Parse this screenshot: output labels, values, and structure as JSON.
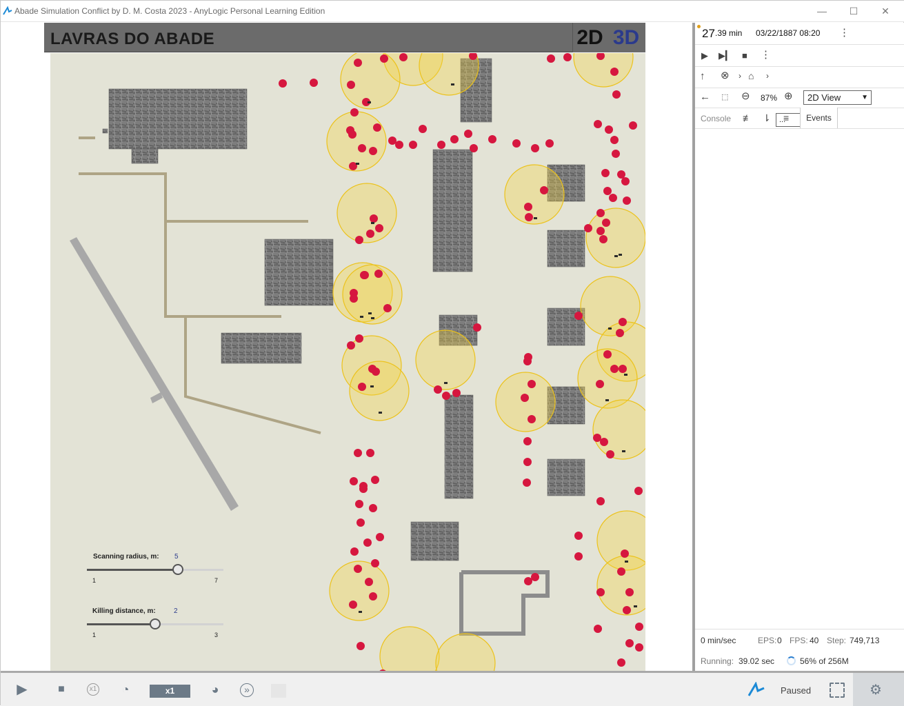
{
  "window": {
    "title": "Abade Simulation Conflict by D. M. Costa 2023 - AnyLogic Personal Learning Edition",
    "minimize_glyph": "—",
    "maximize_glyph": "☐",
    "close_glyph": "✕"
  },
  "header": {
    "title": "LAVRAS DO ABADE",
    "btn_2d": "2D",
    "btn_3d": "3D"
  },
  "sliders": {
    "scanning": {
      "label": "Scanning radius, m:",
      "value": "5",
      "min": "1",
      "max": "7",
      "fraction": 0.6667
    },
    "killing": {
      "label": "Killing distance, m:",
      "value": "2",
      "min": "1",
      "max": "3",
      "fraction": 0.5
    }
  },
  "side_panel": {
    "time_value": "27",
    "time_decimals": ".39 min",
    "date": "03/22/1887 08:20",
    "nav_select": "...",
    "zoom": "87%",
    "view_select": "2D View",
    "tab_console": "Console",
    "tab_events": "Events",
    "stats": {
      "speed": "0 min/sec",
      "eps_label": "EPS:",
      "eps": "0",
      "fps_label": "FPS:",
      "fps": "40",
      "step_label": "Step:",
      "step": "749,713",
      "running_label": "Running:",
      "running": "39.02 sec",
      "memory": "56% of 256M"
    }
  },
  "bottom_bar": {
    "speed": "x1",
    "status": "Paused"
  },
  "colors": {
    "map_ground": "#e3e3d6",
    "agent_red": "#d6173f",
    "scan_circle_fill": "#f4d545",
    "scan_circle_stroke": "#ecc21a",
    "header_bg": "#6b6b6b",
    "accent_3d": "#2b3a8c"
  },
  "icons": [
    "anylogic-logo-icon",
    "play-icon",
    "step-icon",
    "stop-icon",
    "more-icon",
    "up-arrow-icon",
    "home-icon",
    "back-arrow-icon",
    "zoom-fit-icon",
    "zoom-out-icon",
    "zoom-in-icon",
    "clear-console-icon",
    "sort-icon",
    "wrap-icon",
    "x1-reset-icon",
    "slow-down-icon",
    "speed-up-icon",
    "fast-forward-icon",
    "fullscreen-icon",
    "settings-gear-icon",
    "memory-spinner-icon"
  ]
}
